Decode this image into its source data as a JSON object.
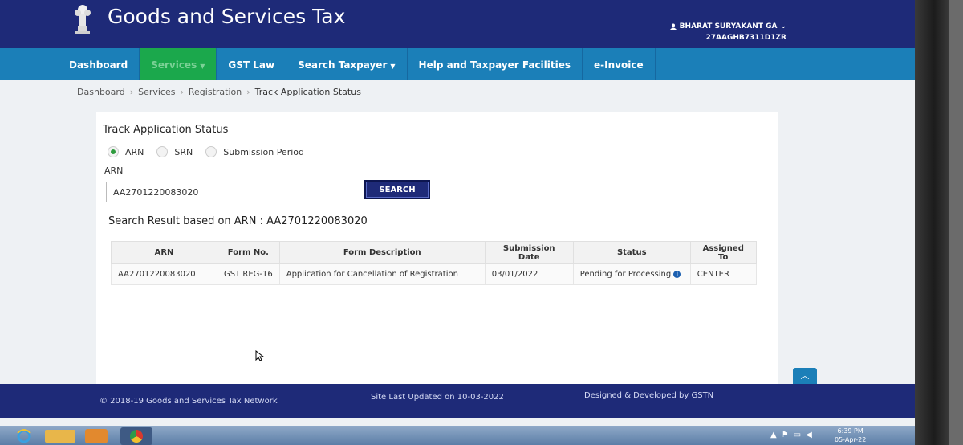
{
  "header": {
    "title": "Goods and Services Tax",
    "user_name": "BHARAT SURYAKANT GA",
    "user_id": "27AAGHB7311D1ZR"
  },
  "nav": {
    "items": [
      {
        "label": "Dashboard"
      },
      {
        "label": "Services"
      },
      {
        "label": "GST Law"
      },
      {
        "label": "Search Taxpayer"
      },
      {
        "label": "Help and Taxpayer Facilities"
      },
      {
        "label": "e-Invoice"
      }
    ]
  },
  "breadcrumb": [
    "Dashboard",
    "Services",
    "Registration",
    "Track Application Status"
  ],
  "panel": {
    "title": "Track Application Status",
    "radios": [
      {
        "label": "ARN",
        "selected": true
      },
      {
        "label": "SRN",
        "selected": false
      },
      {
        "label": "Submission Period",
        "selected": false
      }
    ],
    "field_label": "ARN",
    "arn_value": "AA2701220083020",
    "search_label": "SEARCH",
    "result_title": "Search Result based on ARN : AA2701220083020"
  },
  "table": {
    "headers": [
      "ARN",
      "Form No.",
      "Form Description",
      "Submission Date",
      "Status",
      "Assigned To"
    ],
    "rows": [
      [
        "AA2701220083020",
        "GST REG-16",
        "Application for Cancellation of Registration",
        "03/01/2022",
        "Pending for Processing",
        "CENTER"
      ]
    ]
  },
  "footer": {
    "copyright": "© 2018-19 Goods and Services Tax Network",
    "updated": "Site Last Updated on 10-03-2022",
    "designed": "Designed & Developed by GSTN"
  },
  "taskbar": {
    "time": "6:39 PM",
    "date": "05-Apr-22"
  },
  "colors": {
    "header": "#1e2a78",
    "nav": "#1b7fb8",
    "nav_active": "#1ba84c"
  }
}
